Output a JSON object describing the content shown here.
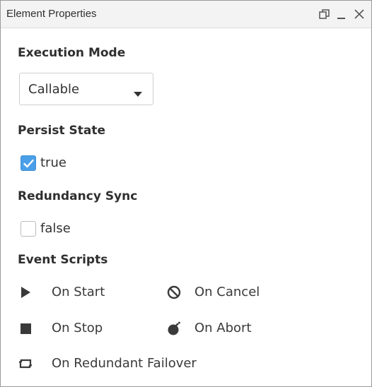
{
  "window": {
    "title": "Element Properties",
    "controls": [
      "restore-icon",
      "minimize-icon",
      "close-icon"
    ]
  },
  "execution_mode": {
    "label": "Execution Mode",
    "selected": "Callable"
  },
  "persist_state": {
    "label": "Persist State",
    "checked": true,
    "value_text": "true"
  },
  "redundancy_sync": {
    "label": "Redundancy Sync",
    "checked": false,
    "value_text": "false"
  },
  "event_scripts": {
    "label": "Event Scripts",
    "items": [
      {
        "label": "On Start",
        "icon": "play-icon"
      },
      {
        "label": "On Cancel",
        "icon": "cancel-icon"
      },
      {
        "label": "On Stop",
        "icon": "stop-icon"
      },
      {
        "label": "On Abort",
        "icon": "bomb-icon"
      },
      {
        "label": "On Redundant Failover",
        "icon": "failover-icon"
      }
    ]
  },
  "colors": {
    "checkbox_checked": "#4a9fe8",
    "icon": "#3a3a3a",
    "titlebar": "#f3f3f3"
  }
}
